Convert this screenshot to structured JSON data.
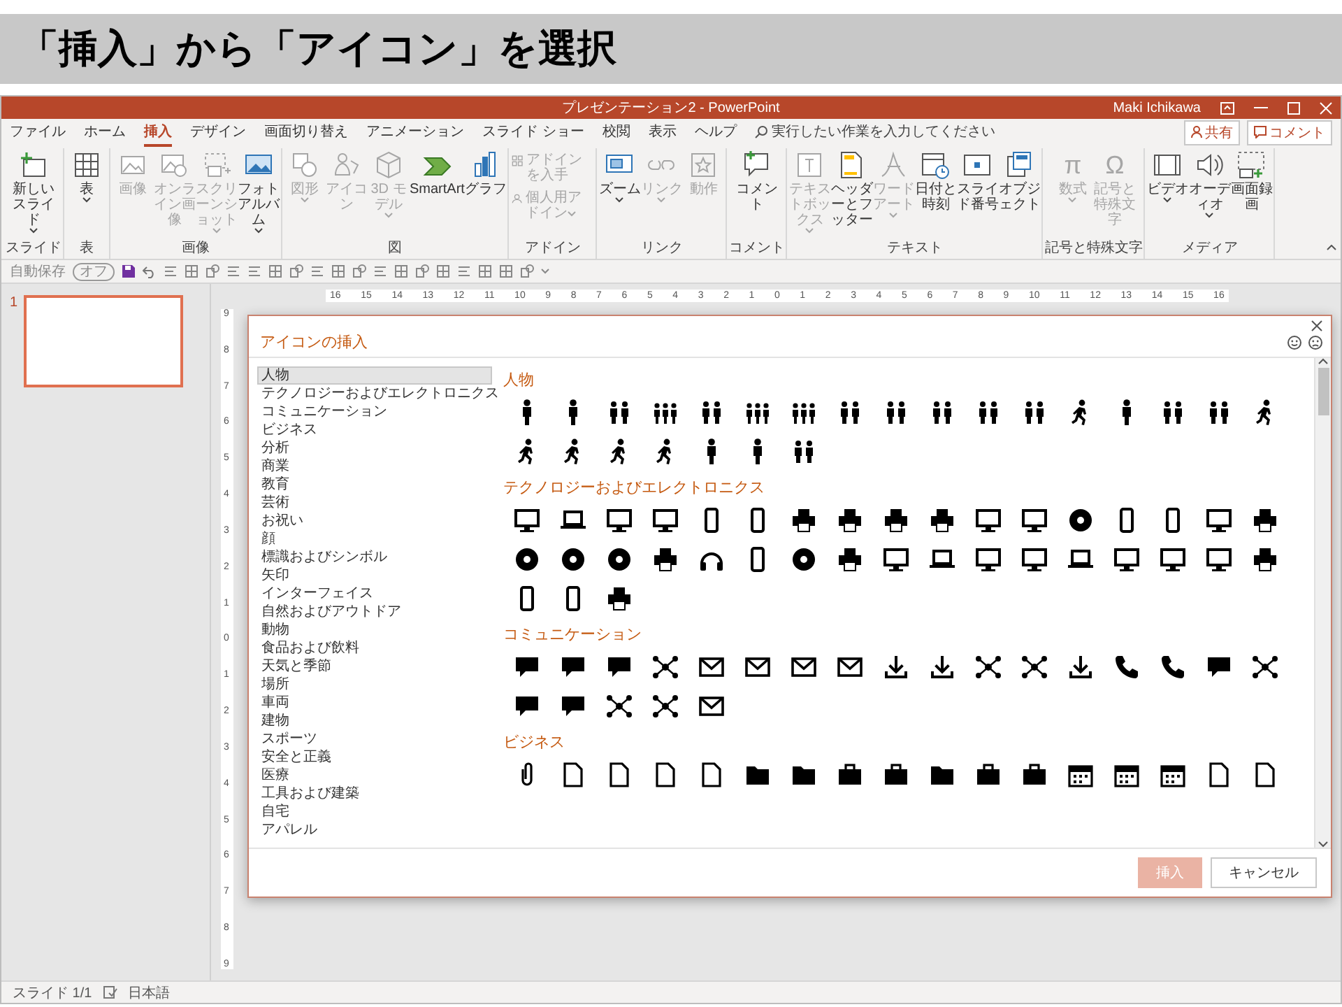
{
  "banner": {
    "title": "「挿入」から「アイコン」を選択"
  },
  "window": {
    "title": "プレゼンテーション2 - PowerPoint",
    "user": "Maki Ichikawa"
  },
  "tabs": [
    {
      "label": "ファイル",
      "selected": false
    },
    {
      "label": "ホーム",
      "selected": false
    },
    {
      "label": "挿入",
      "selected": true
    },
    {
      "label": "デザイン",
      "selected": false
    },
    {
      "label": "画面切り替え",
      "selected": false
    },
    {
      "label": "アニメーション",
      "selected": false
    },
    {
      "label": "スライド ショー",
      "selected": false
    },
    {
      "label": "校閲",
      "selected": false
    },
    {
      "label": "表示",
      "selected": false
    },
    {
      "label": "ヘルプ",
      "selected": false
    }
  ],
  "tell_me": {
    "placeholder": "実行したい作業を入力してください"
  },
  "share_button": {
    "label": "共有"
  },
  "comment_button": {
    "label": "コメント"
  },
  "ribbon_groups": [
    {
      "label": "スライド",
      "buttons": [
        {
          "kind": "large",
          "label": "新しいスライド",
          "disabled": false,
          "dropdown": true
        }
      ]
    },
    {
      "label": "表",
      "buttons": [
        {
          "kind": "large",
          "label": "表",
          "disabled": false,
          "dropdown": true
        }
      ]
    },
    {
      "label": "画像",
      "buttons": [
        {
          "kind": "large",
          "label": "画像",
          "disabled": true,
          "dropdown": false
        },
        {
          "kind": "large",
          "label": "オンライン画像",
          "disabled": true,
          "dropdown": false
        },
        {
          "kind": "large",
          "label": "スクリーンショット",
          "disabled": true,
          "dropdown": true
        },
        {
          "kind": "large",
          "label": "フォトアルバム",
          "disabled": false,
          "dropdown": true
        }
      ]
    },
    {
      "label": "図",
      "buttons": [
        {
          "kind": "large",
          "label": "図形",
          "disabled": true,
          "dropdown": true
        },
        {
          "kind": "large",
          "label": "アイコン",
          "disabled": true,
          "dropdown": false
        },
        {
          "kind": "large",
          "label": "3D モデル",
          "disabled": true,
          "dropdown": true
        },
        {
          "kind": "large",
          "label": "SmartArt",
          "disabled": false,
          "dropdown": false
        },
        {
          "kind": "large",
          "label": "グラフ",
          "disabled": false,
          "dropdown": false
        }
      ]
    },
    {
      "label": "アドイン",
      "buttons": [
        {
          "kind": "small",
          "label": "アドインを入手",
          "disabled": true,
          "dropdown": false
        },
        {
          "kind": "small",
          "label": "個人用アドイン",
          "disabled": true,
          "dropdown": true
        }
      ]
    },
    {
      "label": "リンク",
      "buttons": [
        {
          "kind": "large",
          "label": "ズーム",
          "disabled": false,
          "dropdown": true
        },
        {
          "kind": "large",
          "label": "リンク",
          "disabled": true,
          "dropdown": true
        },
        {
          "kind": "large",
          "label": "動作",
          "disabled": true,
          "dropdown": false
        }
      ]
    },
    {
      "label": "コメント",
      "buttons": [
        {
          "kind": "large",
          "label": "コメント",
          "disabled": false,
          "dropdown": false
        }
      ]
    },
    {
      "label": "テキスト",
      "buttons": [
        {
          "kind": "large",
          "label": "テキストボックス",
          "disabled": true,
          "dropdown": true
        },
        {
          "kind": "large",
          "label": "ヘッダーとフッター",
          "disabled": false,
          "dropdown": false
        },
        {
          "kind": "large",
          "label": "ワードアート",
          "disabled": true,
          "dropdown": true
        },
        {
          "kind": "large",
          "label": "日付と時刻",
          "disabled": false,
          "dropdown": false
        },
        {
          "kind": "large",
          "label": "スライド番号",
          "disabled": false,
          "dropdown": false
        },
        {
          "kind": "large",
          "label": "オブジェクト",
          "disabled": false,
          "dropdown": false
        }
      ]
    },
    {
      "label": "記号と特殊文字",
      "buttons": [
        {
          "kind": "large",
          "label": "数式",
          "glyph": "π",
          "disabled": true,
          "dropdown": true
        },
        {
          "kind": "large",
          "label": "記号と特殊文字",
          "glyph": "Ω",
          "disabled": true,
          "dropdown": false
        }
      ]
    },
    {
      "label": "メディア",
      "buttons": [
        {
          "kind": "large",
          "label": "ビデオ",
          "disabled": false,
          "dropdown": true
        },
        {
          "kind": "large",
          "label": "オーディオ",
          "disabled": false,
          "dropdown": true
        },
        {
          "kind": "large",
          "label": "画面録画",
          "disabled": false,
          "dropdown": false
        }
      ]
    }
  ],
  "quick_access": {
    "autosave_label": "自動保存",
    "autosave_toggle": {
      "label": "オフ",
      "on": false
    }
  },
  "slides": [
    {
      "number": "1",
      "selected": true
    }
  ],
  "ruler": {
    "horizontal": [
      "16",
      "15",
      "14",
      "13",
      "12",
      "11",
      "10",
      "9",
      "8",
      "7",
      "6",
      "5",
      "4",
      "3",
      "2",
      "1",
      "0",
      "1",
      "2",
      "3",
      "4",
      "5",
      "6",
      "7",
      "8",
      "9",
      "10",
      "11",
      "12",
      "13",
      "14",
      "15",
      "16"
    ],
    "vertical": [
      "9",
      "8",
      "7",
      "6",
      "5",
      "4",
      "3",
      "2",
      "1",
      "0",
      "1",
      "2",
      "3",
      "4",
      "5",
      "6",
      "7",
      "8",
      "9"
    ]
  },
  "dialog": {
    "title": "アイコンの挿入",
    "categories": [
      {
        "label": "人物",
        "selected": true
      },
      {
        "label": "テクノロジーおよびエレクトロニクス",
        "selected": false
      },
      {
        "label": "コミュニケーション",
        "selected": false
      },
      {
        "label": "ビジネス",
        "selected": false
      },
      {
        "label": "分析",
        "selected": false
      },
      {
        "label": "商業",
        "selected": false
      },
      {
        "label": "教育",
        "selected": false
      },
      {
        "label": "芸術",
        "selected": false
      },
      {
        "label": "お祝い",
        "selected": false
      },
      {
        "label": "顔",
        "selected": false
      },
      {
        "label": "標識およびシンボル",
        "selected": false
      },
      {
        "label": "矢印",
        "selected": false
      },
      {
        "label": "インターフェイス",
        "selected": false
      },
      {
        "label": "自然およびアウトドア",
        "selected": false
      },
      {
        "label": "動物",
        "selected": false
      },
      {
        "label": "食品および飲料",
        "selected": false
      },
      {
        "label": "天気と季節",
        "selected": false
      },
      {
        "label": "場所",
        "selected": false
      },
      {
        "label": "車両",
        "selected": false
      },
      {
        "label": "建物",
        "selected": false
      },
      {
        "label": "スポーツ",
        "selected": false
      },
      {
        "label": "安全と正義",
        "selected": false
      },
      {
        "label": "医療",
        "selected": false
      },
      {
        "label": "工具および建築",
        "selected": false
      },
      {
        "label": "自宅",
        "selected": false
      },
      {
        "label": "アパレル",
        "selected": false
      }
    ],
    "sections": [
      {
        "title": "人物"
      },
      {
        "title": "テクノロジーおよびエレクトロニクス"
      },
      {
        "title": "コミュニケーション"
      },
      {
        "title": "ビジネス"
      }
    ],
    "buttons": [
      {
        "kind": "primary",
        "label": "挿入",
        "disabled": true
      },
      {
        "kind": "secondary",
        "label": "キャンセル",
        "disabled": false
      }
    ]
  },
  "status_bar": {
    "slide": "スライド 1/1",
    "language": "日本語"
  }
}
